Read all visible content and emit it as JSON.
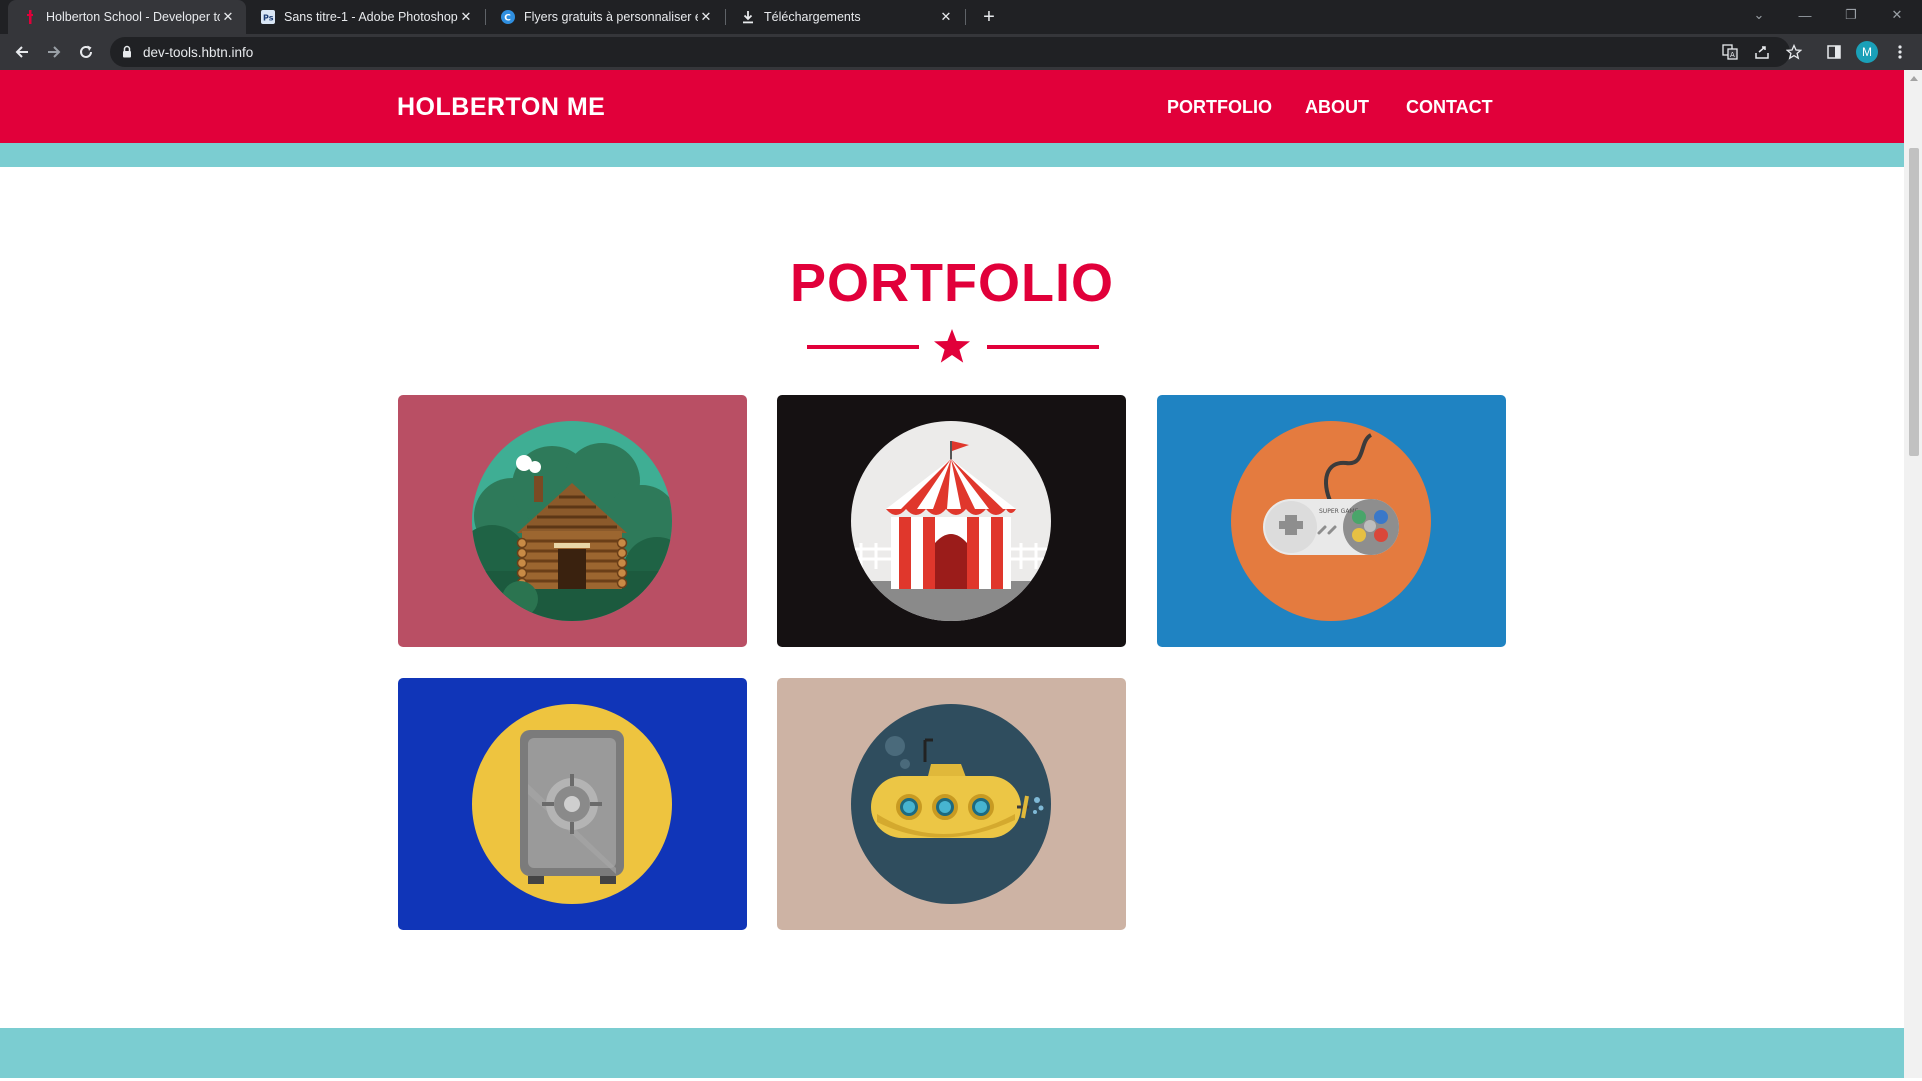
{
  "browser": {
    "tabs": [
      {
        "title": "Holberton School - Developer to",
        "active": true
      },
      {
        "title": "Sans titre-1 - Adobe Photoshop",
        "active": false
      },
      {
        "title": "Flyers gratuits à personnaliser en",
        "active": false
      },
      {
        "title": "Téléchargements",
        "active": false
      }
    ],
    "url": "dev-tools.hbtn.info",
    "profile_initial": "M"
  },
  "site": {
    "brand": "HOLBERTON ME",
    "nav": [
      "PORTFOLIO",
      "ABOUT",
      "CONTACT"
    ]
  },
  "portfolio": {
    "title": "PORTFOLIO",
    "items": [
      {
        "subject": "log-cabin",
        "background": "#b94f64",
        "circle": "#3fae94"
      },
      {
        "subject": "circus-tent",
        "background": "#151112",
        "circle": "#ecebea"
      },
      {
        "subject": "game-controller",
        "background": "#1f83c2",
        "circle": "#e47b3f"
      },
      {
        "subject": "safe",
        "background": "#1035b8",
        "circle": "#eec43f"
      },
      {
        "subject": "submarine",
        "background": "#cdb3a4",
        "circle": "#2f4d5e"
      }
    ]
  },
  "colors": {
    "brand_red": "#e1003a",
    "teal": "#7bcdd1"
  }
}
